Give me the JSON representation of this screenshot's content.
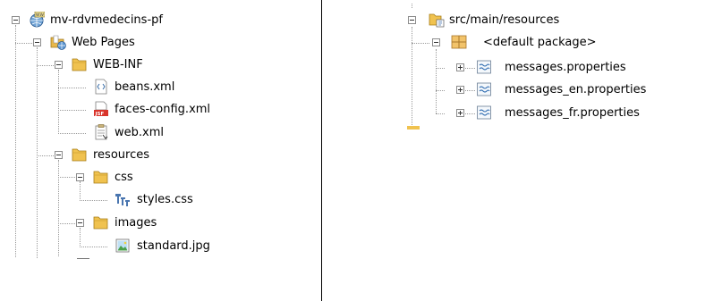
{
  "left_tree": {
    "project": {
      "label": "mv-rdvmedecins-pf",
      "icon": "web-project-icon"
    },
    "web_pages": {
      "label": "Web Pages",
      "icon": "web-pages-folder-icon"
    },
    "web_inf": {
      "label": "WEB-INF",
      "icon": "folder-icon"
    },
    "beans_xml": {
      "label": "beans.xml",
      "icon": "xml-file-icon"
    },
    "faces_config_xml": {
      "label": "faces-config.xml",
      "icon": "jsf-config-icon"
    },
    "web_xml": {
      "label": "web.xml",
      "icon": "web-xml-icon"
    },
    "resources": {
      "label": "resources",
      "icon": "folder-icon"
    },
    "css": {
      "label": "css",
      "icon": "folder-icon"
    },
    "styles_css": {
      "label": "styles.css",
      "icon": "css-file-icon"
    },
    "images": {
      "label": "images",
      "icon": "folder-icon"
    },
    "standard_jpg": {
      "label": "standard.jpg",
      "icon": "image-file-icon"
    }
  },
  "right_tree": {
    "src_main_resources": {
      "label": "src/main/resources",
      "icon": "source-folder-icon"
    },
    "default_package": {
      "label": "<default package>",
      "icon": "package-icon"
    },
    "messages": {
      "label": "messages.properties",
      "icon": "properties-file-icon"
    },
    "messages_en": {
      "label": "messages_en.properties",
      "icon": "properties-file-icon"
    },
    "messages_fr": {
      "label": "messages_fr.properties",
      "icon": "properties-file-icon"
    }
  }
}
